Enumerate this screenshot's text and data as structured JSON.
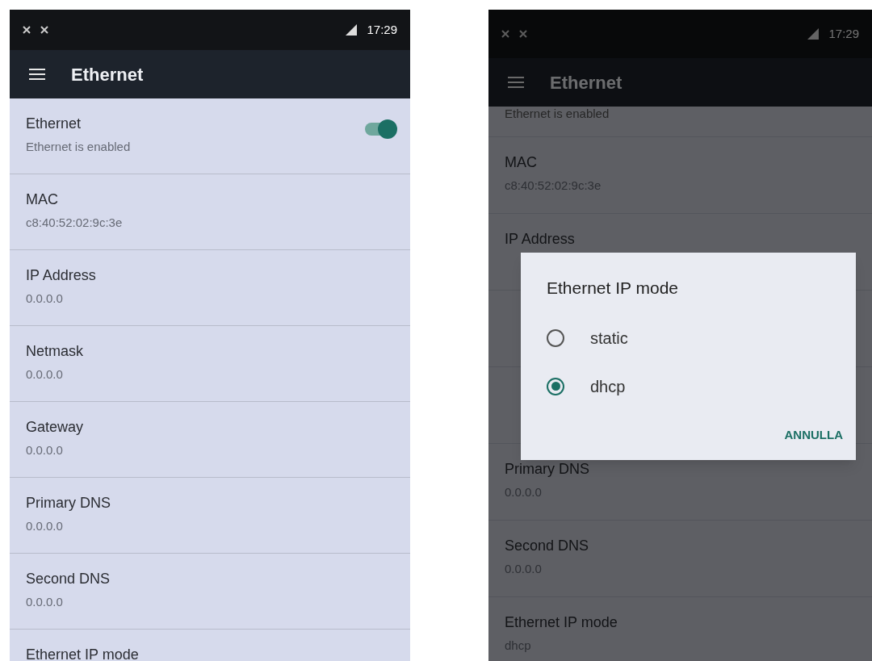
{
  "screens": [
    {
      "status_bar": {
        "time": "17:29"
      },
      "toolbar": {
        "title": "Ethernet"
      },
      "dimmed": false,
      "items": [
        {
          "kind": "switch",
          "title": "Ethernet",
          "subtitle": "Ethernet is enabled",
          "on": true
        },
        {
          "kind": "info",
          "title": "MAC",
          "subtitle": "c8:40:52:02:9c:3e"
        },
        {
          "kind": "info",
          "title": "IP Address",
          "subtitle": "0.0.0.0"
        },
        {
          "kind": "info",
          "title": "Netmask",
          "subtitle": "0.0.0.0"
        },
        {
          "kind": "info",
          "title": "Gateway",
          "subtitle": "0.0.0.0"
        },
        {
          "kind": "info",
          "title": "Primary DNS",
          "subtitle": "0.0.0.0"
        },
        {
          "kind": "info",
          "title": "Second DNS",
          "subtitle": "0.0.0.0"
        },
        {
          "kind": "info",
          "title": "Ethernet IP mode"
        }
      ]
    },
    {
      "status_bar": {
        "time": "17:29"
      },
      "toolbar": {
        "title": "Ethernet"
      },
      "dimmed": true,
      "items": [
        {
          "kind": "cut",
          "subtitle": "Ethernet is enabled"
        },
        {
          "kind": "info",
          "title": "MAC",
          "subtitle": "c8:40:52:02:9c:3e"
        },
        {
          "kind": "info",
          "title": "IP Address"
        },
        {
          "kind": "covered"
        },
        {
          "kind": "covered"
        },
        {
          "kind": "info",
          "title": "Primary DNS",
          "subtitle": "0.0.0.0"
        },
        {
          "kind": "info",
          "title": "Second DNS",
          "subtitle": "0.0.0.0"
        },
        {
          "kind": "info",
          "title": "Ethernet IP mode",
          "subtitle": "dhcp"
        }
      ],
      "dialog": {
        "title": "Ethernet IP mode",
        "options": [
          {
            "label": "static",
            "selected": false
          },
          {
            "label": "dhcp",
            "selected": true
          }
        ],
        "button": "ANNULLA"
      }
    }
  ]
}
